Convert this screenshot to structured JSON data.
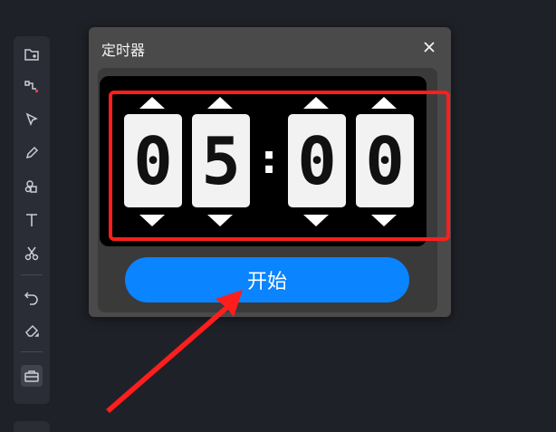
{
  "dialog": {
    "title": "定时器",
    "close_icon": "close-icon"
  },
  "timer": {
    "digits": [
      "0",
      "5",
      "0",
      "0"
    ],
    "separator": ":"
  },
  "start_button": {
    "label": "开始"
  },
  "toolbar": {
    "tools": [
      "add-frame-icon",
      "connector-icon",
      "cursor-select-icon",
      "pen-icon",
      "shapes-icon",
      "text-icon",
      "scissors-icon",
      "undo-icon",
      "eraser-icon",
      "toolbox-icon"
    ]
  },
  "colors": {
    "accent": "#0a84ff",
    "annotation": "#ff1e1e",
    "background": "#1f2128"
  }
}
